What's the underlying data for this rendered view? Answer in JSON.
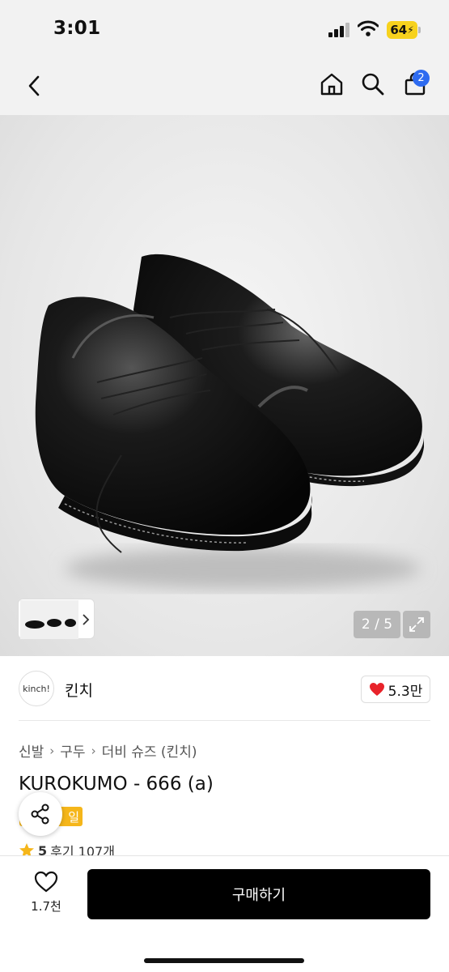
{
  "status_bar": {
    "time": "3:01",
    "battery": "64"
  },
  "nav": {
    "back_icon": "chevron-left-icon",
    "home_icon": "home-icon",
    "search_icon": "search-icon",
    "cart_icon": "shopping-bag-icon",
    "cart_count": "2"
  },
  "gallery": {
    "page_indicator": "2 / 5",
    "expand_icon": "expand-icon",
    "thumbnail_next_icon": "chevron-right-icon"
  },
  "brand": {
    "logo_text": "kinch!",
    "name": "킨치",
    "like_count": "5.3만",
    "like_icon": "heart-icon",
    "like_color": "#e8232a"
  },
  "breadcrumb": [
    "신발",
    "구두",
    "더비 슈즈 (킨치)"
  ],
  "product": {
    "title": "KUROKUMO - 666 (a)",
    "promo_badge": "일",
    "rating": "5",
    "review_text": "후기 107개"
  },
  "bottom_bar": {
    "wish_count": "1.7천",
    "buy_label": "구매하기"
  },
  "colors": {
    "accent_badge": "#2e6bf0",
    "promo": "#f5b61a",
    "buy_button": "#000000",
    "star": "#f5b61a"
  }
}
